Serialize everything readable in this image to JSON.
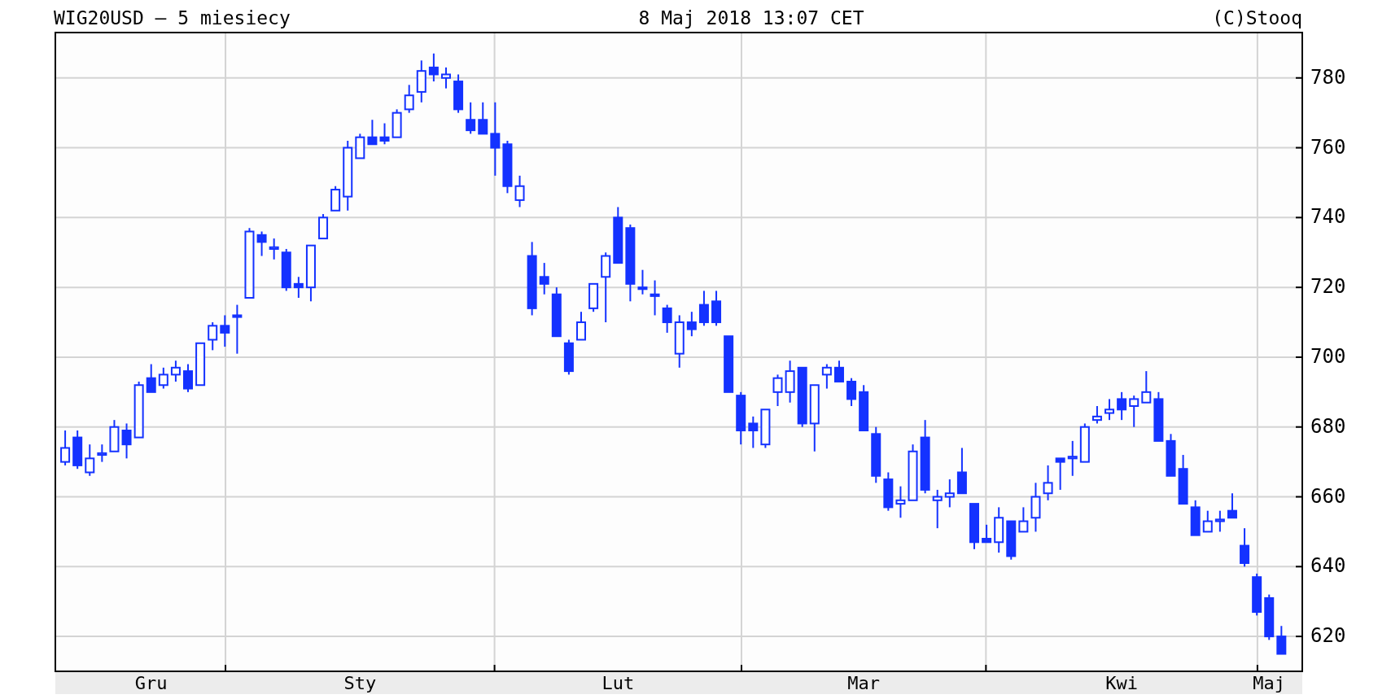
{
  "header": {
    "title": "WIG20USD – 5 miesiecy",
    "timestamp": "8 Maj 2018 13:07 CET",
    "copyright": "(C)Stooq"
  },
  "chart_data": {
    "type": "candlestick",
    "grid": true,
    "ylim": [
      610,
      793
    ],
    "yticks": [
      620,
      640,
      660,
      680,
      700,
      720,
      740,
      760,
      780
    ],
    "categories": [
      null,
      null,
      null,
      null,
      null,
      null,
      null,
      "Gru",
      null,
      null,
      null,
      null,
      null,
      null,
      null,
      null,
      null,
      null,
      null,
      null,
      null,
      null,
      null,
      null,
      "Sty",
      null,
      null,
      null,
      null,
      null,
      null,
      null,
      null,
      null,
      null,
      null,
      null,
      null,
      null,
      null,
      null,
      null,
      null,
      null,
      null,
      "Lut",
      null,
      null,
      null,
      null,
      null,
      null,
      null,
      null,
      null,
      null,
      null,
      null,
      null,
      null,
      null,
      null,
      null,
      null,
      null,
      "Mar",
      null,
      null,
      null,
      null,
      null,
      null,
      null,
      null,
      null,
      null,
      null,
      null,
      null,
      null,
      null,
      null,
      null,
      null,
      null,
      null,
      "Kwi",
      null,
      null,
      null,
      null,
      null,
      null,
      null,
      null,
      null,
      null,
      null,
      "Maj",
      null
    ],
    "ohlc": [
      [
        670,
        679,
        669,
        674
      ],
      [
        677,
        679,
        668,
        669
      ],
      [
        667,
        675,
        666,
        671
      ],
      [
        672,
        675,
        670,
        672.5
      ],
      [
        673,
        682,
        673,
        680
      ],
      [
        679,
        681,
        671,
        675
      ],
      [
        677,
        693,
        677,
        692
      ],
      [
        694,
        698,
        690,
        690
      ],
      [
        692,
        697,
        691,
        695
      ],
      [
        695,
        699,
        693,
        697
      ],
      [
        696,
        698,
        690,
        691
      ],
      [
        692,
        704,
        692,
        704
      ],
      [
        705,
        710,
        702,
        709
      ],
      [
        709,
        712,
        703,
        707
      ],
      [
        712,
        715,
        701,
        711.5
      ],
      [
        717,
        737,
        717,
        736
      ],
      [
        735,
        736,
        729,
        733
      ],
      [
        731,
        734,
        728,
        731.5
      ],
      [
        730,
        731,
        719,
        720
      ],
      [
        721,
        723,
        717,
        720
      ],
      [
        720,
        732,
        716,
        732
      ],
      [
        734,
        741,
        734,
        740
      ],
      [
        742,
        749,
        742,
        748
      ],
      [
        746,
        762,
        742,
        760
      ],
      [
        757,
        764,
        757,
        763
      ],
      [
        763,
        768,
        761,
        761
      ],
      [
        763,
        767,
        761,
        762
      ],
      [
        763,
        771,
        763,
        770
      ],
      [
        771,
        778,
        770,
        775
      ],
      [
        776,
        785,
        773,
        782
      ],
      [
        783,
        787,
        779,
        781
      ],
      [
        780,
        783,
        777,
        781
      ],
      [
        779,
        781,
        770,
        771
      ],
      [
        768,
        773,
        764,
        765
      ],
      [
        768,
        773,
        764,
        764
      ],
      [
        764,
        773,
        752,
        760
      ],
      [
        761,
        762,
        747,
        749
      ],
      [
        745,
        752,
        743,
        749
      ],
      [
        729,
        733,
        712,
        714
      ],
      [
        723,
        727,
        718,
        721
      ],
      [
        718,
        720,
        706,
        706
      ],
      [
        704,
        705,
        695,
        696
      ],
      [
        705,
        713,
        705,
        710
      ],
      [
        714,
        721,
        713,
        721
      ],
      [
        723,
        730,
        710,
        729
      ],
      [
        740,
        743,
        727,
        727
      ],
      [
        737,
        738,
        716,
        721
      ],
      [
        720,
        725,
        718,
        719.5
      ],
      [
        718,
        722,
        712,
        717.5
      ],
      [
        714,
        715,
        707,
        710
      ],
      [
        701,
        712,
        697,
        710
      ],
      [
        710,
        713,
        706,
        708
      ],
      [
        715,
        719,
        709,
        710
      ],
      [
        716,
        719,
        709,
        710
      ],
      [
        706,
        706,
        690,
        690
      ],
      [
        689,
        690,
        675,
        679
      ],
      [
        681,
        683,
        674,
        679
      ],
      [
        675,
        685,
        674,
        685
      ],
      [
        690,
        695,
        686,
        694
      ],
      [
        690,
        699,
        687,
        696
      ],
      [
        697,
        697,
        680,
        681
      ],
      [
        681,
        692,
        673,
        692
      ],
      [
        695,
        698,
        691,
        697
      ],
      [
        697,
        699,
        693,
        693
      ],
      [
        693,
        694,
        686,
        688
      ],
      [
        690,
        692,
        679,
        679
      ],
      [
        678,
        680,
        664,
        666
      ],
      [
        665,
        667,
        656,
        657
      ],
      [
        658,
        663,
        654,
        659
      ],
      [
        659,
        675,
        659,
        673
      ],
      [
        677,
        682,
        661,
        662
      ],
      [
        659,
        662,
        651,
        660
      ],
      [
        660,
        665,
        657,
        661
      ],
      [
        667,
        674,
        661,
        661
      ],
      [
        658,
        658,
        645,
        647
      ],
      [
        648,
        652,
        647,
        647
      ],
      [
        647,
        657,
        644,
        654
      ],
      [
        653,
        653,
        642,
        643
      ],
      [
        650,
        657,
        650,
        653
      ],
      [
        654,
        664,
        650,
        660
      ],
      [
        661,
        669,
        659,
        664
      ],
      [
        671,
        671,
        662,
        670
      ],
      [
        671,
        676,
        666,
        671.5
      ],
      [
        670,
        681,
        670,
        680
      ],
      [
        682,
        686,
        681,
        683
      ],
      [
        684,
        688,
        682,
        685
      ],
      [
        688,
        690,
        682,
        685
      ],
      [
        686,
        689,
        680,
        688
      ],
      [
        687,
        696,
        687,
        690
      ],
      [
        688,
        690,
        676,
        676
      ],
      [
        676,
        678,
        666,
        666
      ],
      [
        668,
        672,
        658,
        658
      ],
      [
        657,
        659,
        649,
        649
      ],
      [
        650,
        656,
        650,
        653
      ],
      [
        653,
        656,
        650,
        653.5
      ],
      [
        656,
        661,
        654,
        654
      ],
      [
        646,
        651,
        640,
        641
      ],
      [
        637,
        638,
        626,
        627
      ],
      [
        631,
        632,
        619,
        620
      ],
      [
        620,
        623,
        615,
        615
      ]
    ]
  }
}
